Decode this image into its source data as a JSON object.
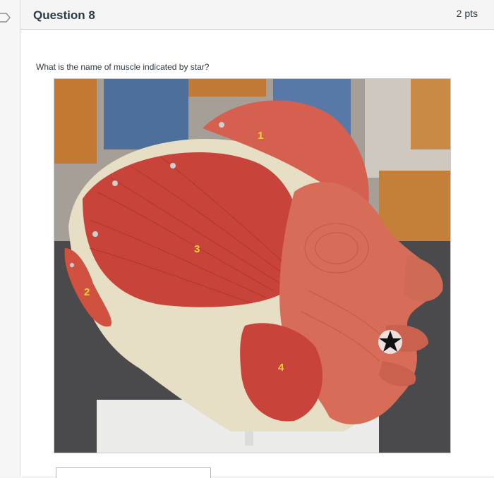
{
  "question": {
    "title": "Question 8",
    "points": "2 pts",
    "prompt": "What is the name of muscle indicated by star?"
  },
  "figure": {
    "labels": [
      "1",
      "2",
      "3",
      "4"
    ],
    "marker": "star"
  }
}
